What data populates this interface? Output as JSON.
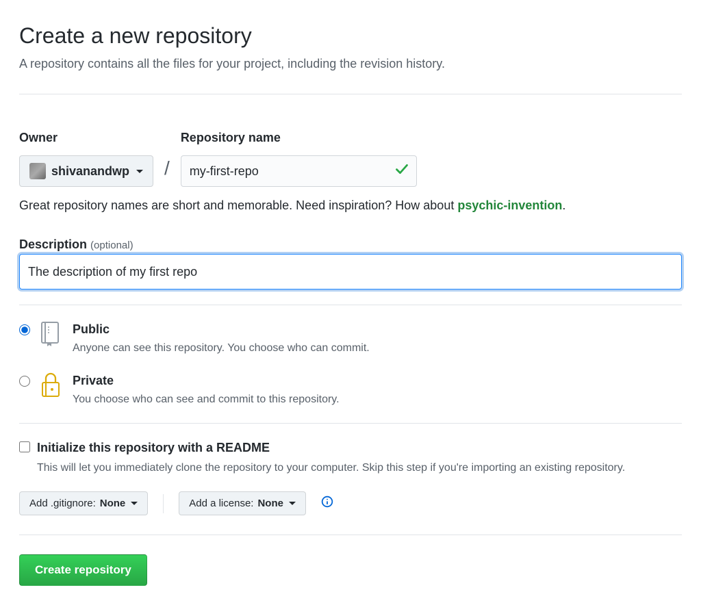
{
  "page": {
    "title": "Create a new repository",
    "subtitle": "A repository contains all the files for your project, including the revision history."
  },
  "owner": {
    "label": "Owner",
    "username": "shivanandwp"
  },
  "repo": {
    "label": "Repository name",
    "value": "my-first-repo"
  },
  "hint": {
    "prefix": "Great repository names are short and memorable. Need inspiration? How about ",
    "suggestion": "psychic-invention",
    "suffix": "."
  },
  "description": {
    "label": "Description",
    "optional": "(optional)",
    "value": "The description of my first repo"
  },
  "visibility": {
    "public": {
      "title": "Public",
      "desc": "Anyone can see this repository. You choose who can commit."
    },
    "private": {
      "title": "Private",
      "desc": "You choose who can see and commit to this repository."
    }
  },
  "readme": {
    "title": "Initialize this repository with a README",
    "desc": "This will let you immediately clone the repository to your computer. Skip this step if you're importing an existing repository."
  },
  "gitignore": {
    "label": "Add .gitignore: ",
    "value": "None"
  },
  "license": {
    "label": "Add a license: ",
    "value": "None"
  },
  "submit": {
    "label": "Create repository"
  }
}
